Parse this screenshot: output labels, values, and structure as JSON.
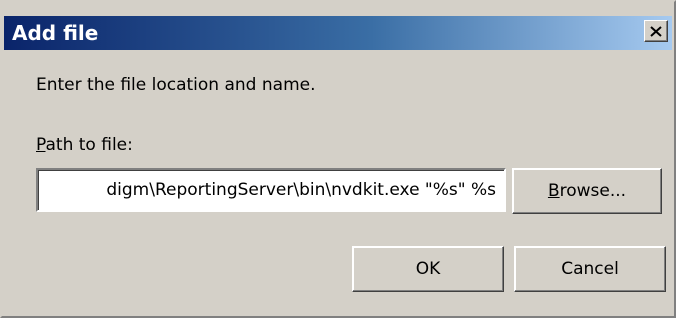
{
  "window": {
    "title": "Add file",
    "close_icon": "close-icon"
  },
  "form": {
    "instruction": "Enter the file location and name.",
    "path_label_mnemonic": "P",
    "path_label_rest": "ath to file:",
    "path_value": "digm\\ReportingServer\\bin\\nvdkit.exe \"%s\" %s"
  },
  "buttons": {
    "browse_mnemonic": "B",
    "browse_rest": "rowse...",
    "ok": "OK",
    "cancel": "Cancel"
  },
  "colors": {
    "dialog_bg": "#d4d0c8",
    "titlebar_start": "#0a246a",
    "titlebar_end": "#a6caf0"
  }
}
